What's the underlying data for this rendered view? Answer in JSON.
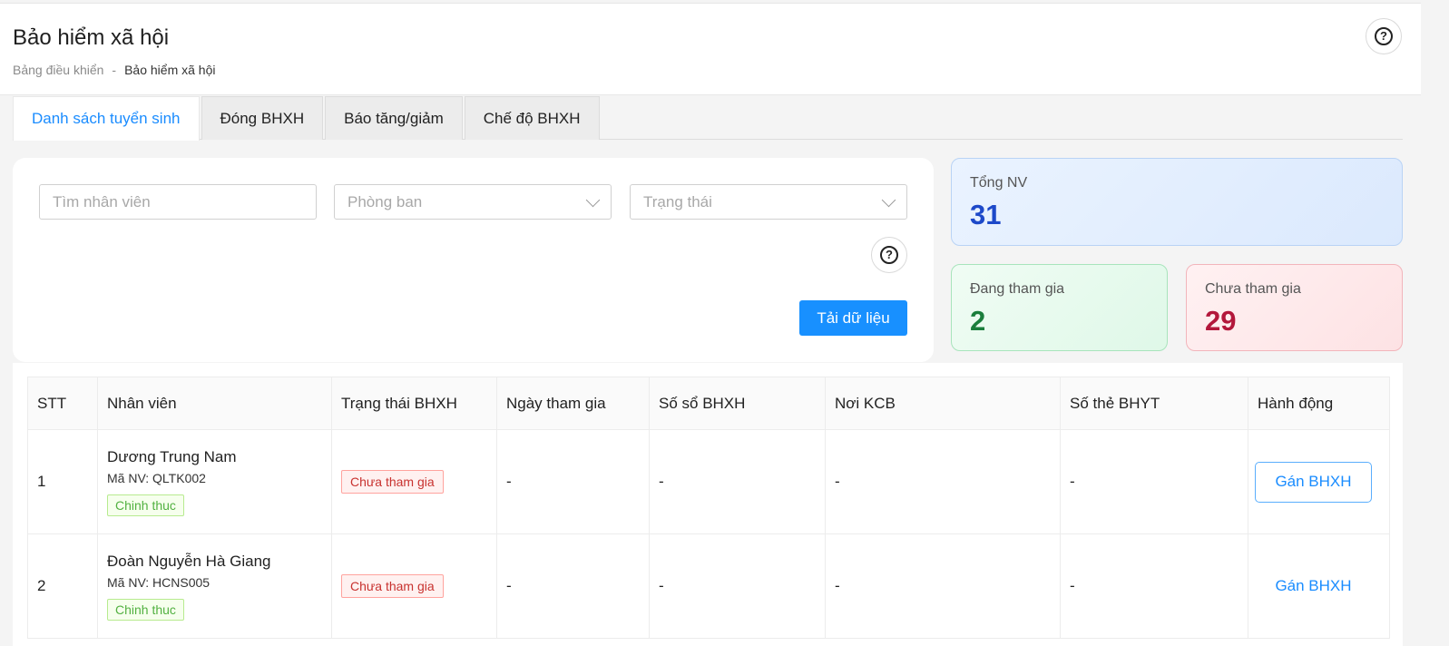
{
  "header": {
    "title": "Bảo hiểm xã hội",
    "breadcrumb": {
      "home": "Bảng điều khiển",
      "separator": "-",
      "current": "Bảo hiểm xã hội"
    }
  },
  "tabs": [
    {
      "label": "Danh sách tuyển sinh",
      "active": true
    },
    {
      "label": "Đóng BHXH",
      "active": false
    },
    {
      "label": "Báo tăng/giảm",
      "active": false
    },
    {
      "label": "Chế độ BHXH",
      "active": false
    }
  ],
  "filters": {
    "search_placeholder": "Tìm nhân viên",
    "department_placeholder": "Phòng ban",
    "status_placeholder": "Trạng thái",
    "load_button": "Tải dữ liệu"
  },
  "stats": {
    "total": {
      "label": "Tổng NV",
      "value": "31"
    },
    "participating": {
      "label": "Đang tham gia",
      "value": "2"
    },
    "not_participating": {
      "label": "Chưa tham gia",
      "value": "29"
    }
  },
  "table": {
    "columns": [
      "STT",
      "Nhân viên",
      "Trạng thái BHXH",
      "Ngày tham gia",
      "Số sổ BHXH",
      "Nơi KCB",
      "Số thẻ BHYT",
      "Hành động"
    ],
    "rows": [
      {
        "stt": "1",
        "name": "Dương Trung Nam",
        "code": "Mã NV: QLTK002",
        "type": "Chinh thuc",
        "status": "Chưa tham gia",
        "join_date": "-",
        "book_no": "-",
        "kcb": "-",
        "card_no": "-",
        "action": "Gán BHXH"
      },
      {
        "stt": "2",
        "name": "Đoàn Nguyễn Hà Giang",
        "code": "Mã NV: HCNS005",
        "type": "Chinh thuc",
        "status": "Chưa tham gia",
        "join_date": "-",
        "book_no": "-",
        "kcb": "-",
        "card_no": "-",
        "action": "Gán BHXH"
      }
    ]
  },
  "colors": {
    "accent": "#1890ff",
    "total_value": "#1d49c9",
    "participating_value": "#1b7e3c",
    "not_participating_value": "#b3173b"
  },
  "icons": {
    "help": "question-circle-icon",
    "dropdown": "chevron-down-icon"
  }
}
